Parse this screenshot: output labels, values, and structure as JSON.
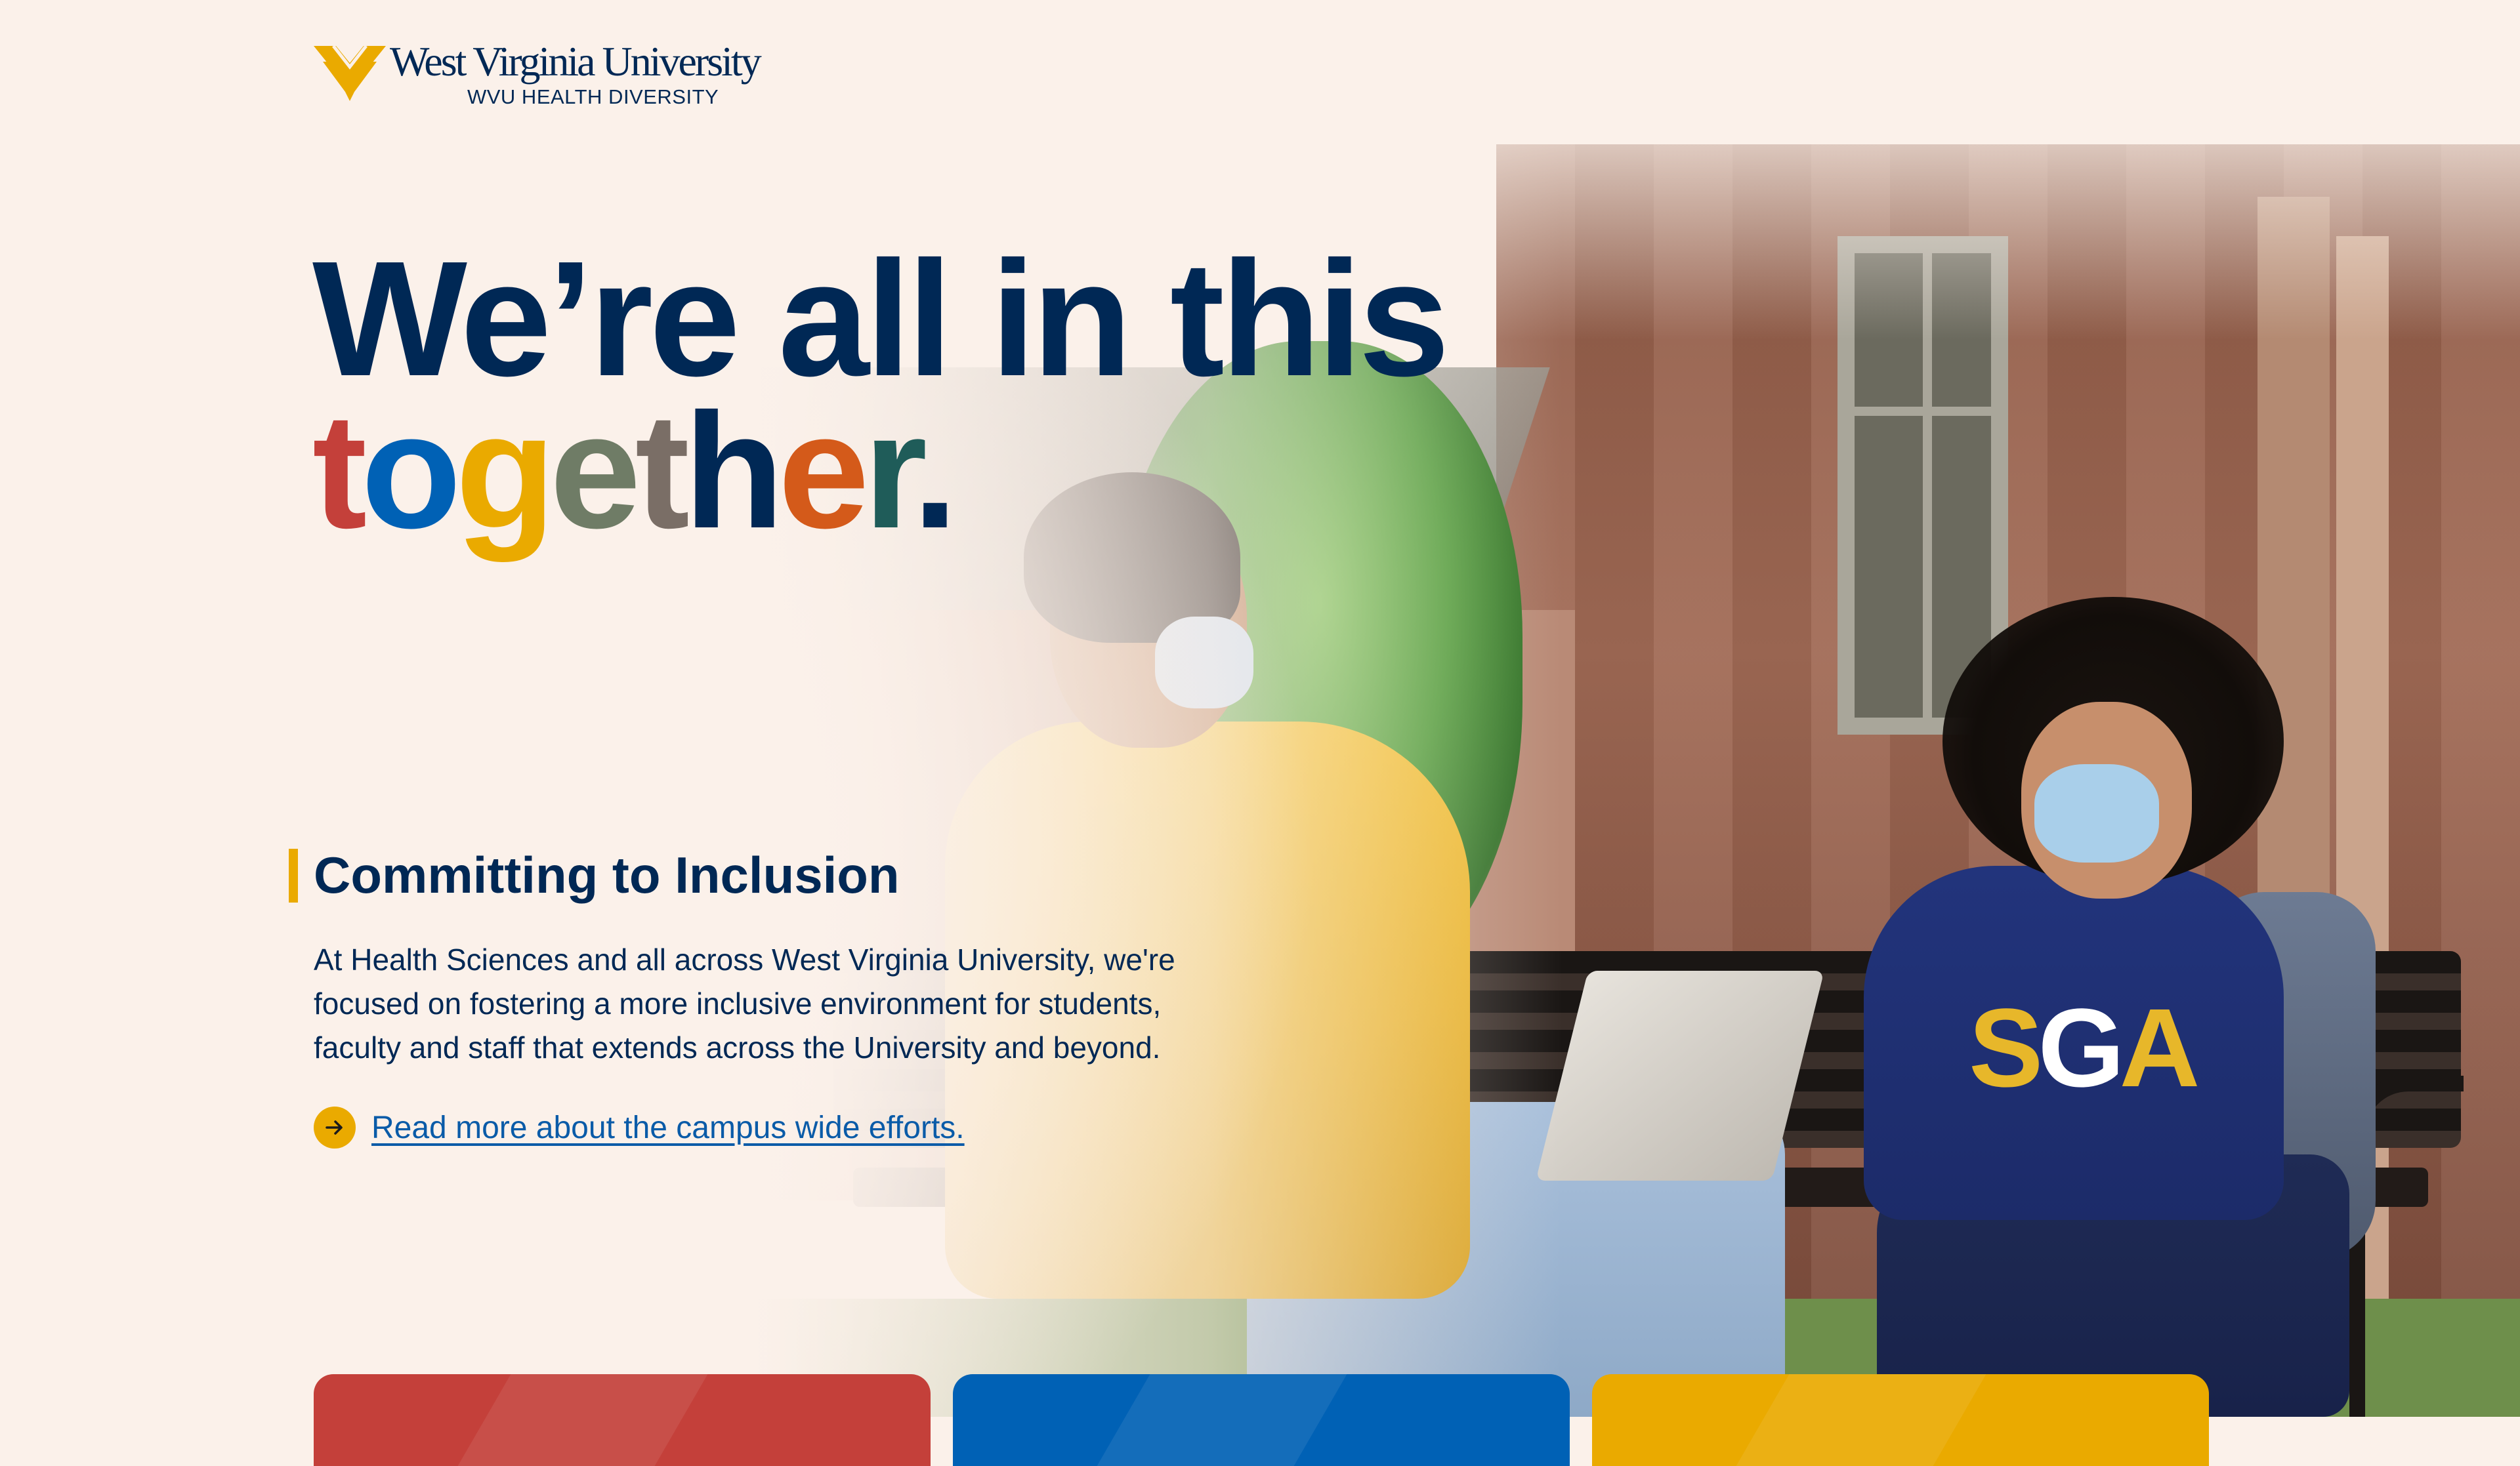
{
  "brand": {
    "name": "West Virginia University",
    "subtitle": "WVU HEALTH DIVERSITY",
    "logo_icon": "flying-wv-icon",
    "colors": {
      "navy": "#002855",
      "gold": "#EAAA00"
    }
  },
  "hero": {
    "line1": "We’re all in this",
    "line2_letters": [
      {
        "char": "t",
        "color": "#C4403A"
      },
      {
        "char": "o",
        "color": "#0061B5"
      },
      {
        "char": "g",
        "color": "#EAAA00"
      },
      {
        "char": "e",
        "color": "#6F7C66"
      },
      {
        "char": "t",
        "color": "#7A6E66"
      },
      {
        "char": "h",
        "color": "#002855"
      },
      {
        "char": "e",
        "color": "#D45A1A"
      },
      {
        "char": "r",
        "color": "#1F5C59"
      },
      {
        "char": ".",
        "color": "#002855"
      }
    ]
  },
  "section": {
    "title": "Committing to Inclusion",
    "body": "At Health Sciences and all across West Virginia University, we're focused on fostering a more inclusive environment for students, faculty and staff that extends across the University and beyond.",
    "link_label": "Read more about the campus wide efforts.",
    "link_icon": "arrow-right-icon"
  },
  "cards": [
    {
      "color": "#C4403A"
    },
    {
      "color": "#0061B5"
    },
    {
      "color": "#EAAA00"
    }
  ]
}
